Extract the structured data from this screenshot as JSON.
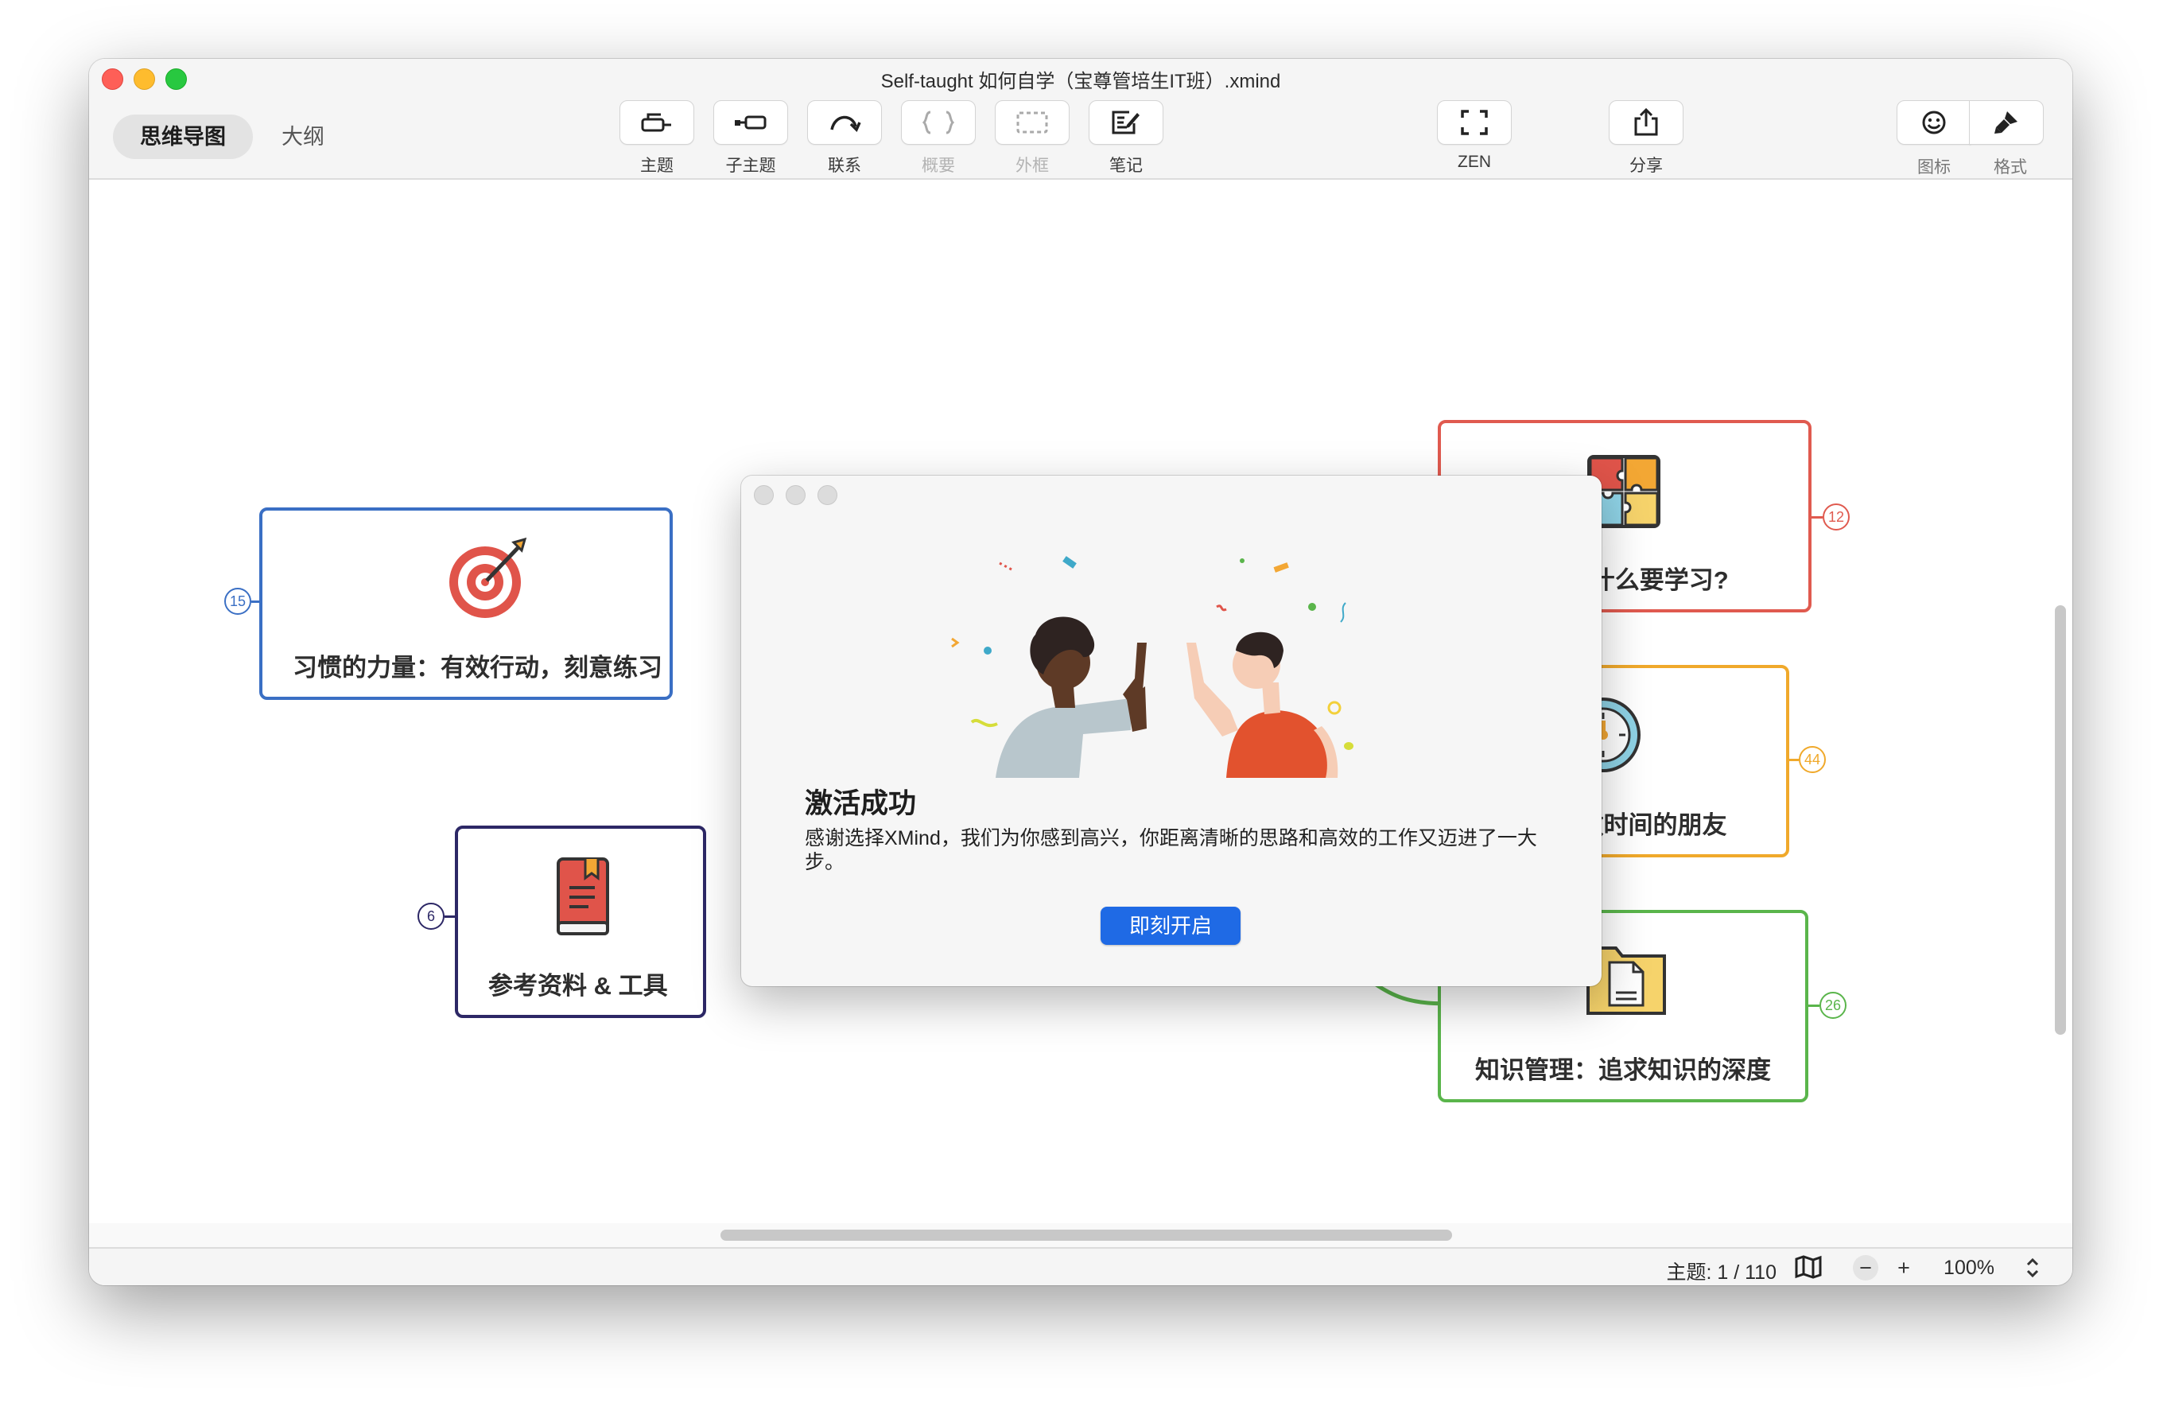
{
  "window": {
    "title": "Self-taught 如何自学（宝尊管培生IT班）.xmind"
  },
  "view_tabs": {
    "mindmap": "思维导图",
    "outline": "大纲"
  },
  "toolbar": {
    "topic": "主题",
    "subtopic": "子主题",
    "relationship": "联系",
    "summary": "概要",
    "boundary": "外框",
    "note": "笔记",
    "zen": "ZEN",
    "share": "分享",
    "icon": "图标",
    "format": "格式"
  },
  "nodes": {
    "habits": {
      "label": "习惯的力量：有效行动，刻意练习",
      "count": "15",
      "color": "#3a6fc4"
    },
    "references": {
      "label": "参考资料 & 工具",
      "count": "6",
      "color": "#2d2866"
    },
    "why": {
      "label": "Why：为什么要学习?",
      "count": "12",
      "color": "#e05a4f"
    },
    "time": {
      "label": "时间管理：做时间的朋友",
      "count": "44",
      "color": "#f0a92b"
    },
    "knowledge": {
      "label": "知识管理：追求知识的深度",
      "count": "26",
      "color": "#5ab54b"
    }
  },
  "dialog": {
    "title": "激活成功",
    "body": "感谢选择XMind，我们为你感到高兴，你距离清晰的思路和高效的工作又迈进了一大步。",
    "button": "即刻开启"
  },
  "status": {
    "topic_count": "主题: 1 / 110",
    "zoom": "100%"
  },
  "icons": [
    "topic-icon",
    "subtopic-icon",
    "relationship-icon",
    "summary-icon",
    "boundary-icon",
    "note-icon",
    "zen-icon",
    "share-icon",
    "emoji-icon",
    "format-brush-icon",
    "target-icon",
    "book-icon",
    "puzzle-icon",
    "clock-icon",
    "document-folder-icon",
    "map-icon"
  ]
}
